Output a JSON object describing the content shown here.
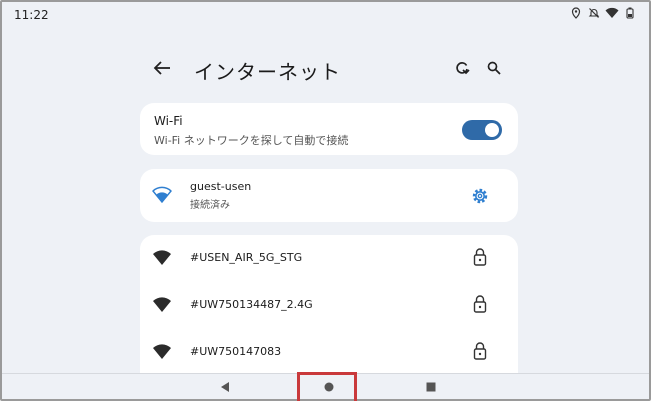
{
  "status_bar": {
    "time": "11:22",
    "icons": [
      "location-icon",
      "notifications-off-icon",
      "wifi-icon",
      "battery-icon"
    ]
  },
  "app_bar": {
    "title": "インターネット",
    "back_icon": "arrow-left-icon",
    "actions": [
      "refresh-icon",
      "search-icon"
    ]
  },
  "wifi_card": {
    "title": "Wi-Fi",
    "subtitle": "Wi-Fi ネットワークを探して自動で接続",
    "toggle_on": true,
    "accent": "#2f6aa8"
  },
  "connected_network": {
    "name": "guest-usen",
    "status": "接続済み",
    "accent": "#2f7fd0",
    "settings_icon": "gear-icon"
  },
  "networks": [
    {
      "name": "#USEN_AIR_5G_STG",
      "locked": true
    },
    {
      "name": "#UW750134487_2.4G",
      "locked": true
    },
    {
      "name": "#UW750147083",
      "locked": true
    }
  ],
  "nav_bar": {
    "buttons": [
      "back-triangle-icon",
      "home-circle-icon",
      "recents-square-icon"
    ],
    "highlight_color": "#c9393b"
  }
}
